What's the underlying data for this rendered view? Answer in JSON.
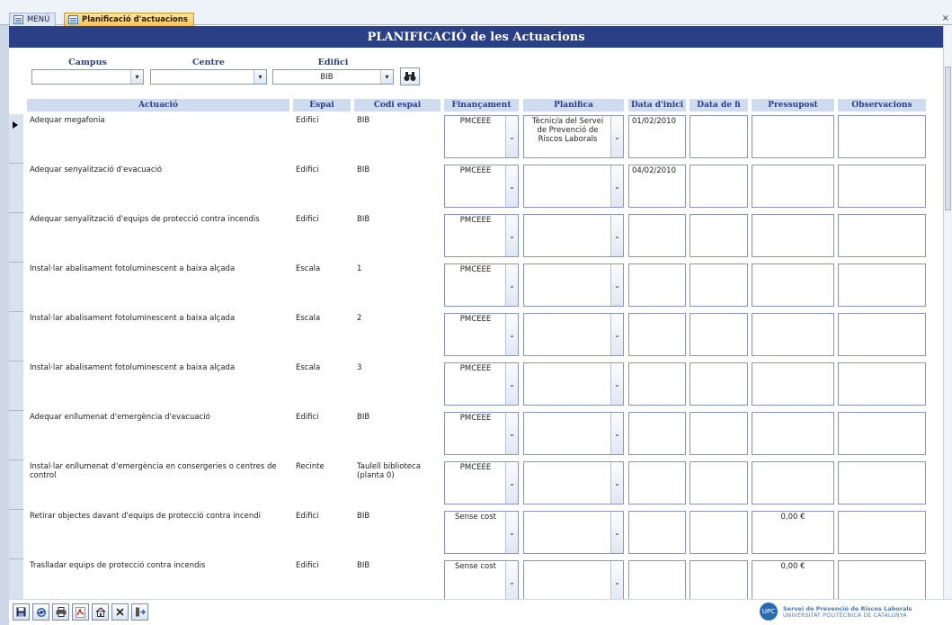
{
  "tabs": {
    "menu_label": "MENÚ",
    "active_label": "Planificació d'actuacions",
    "close_symbol": "×"
  },
  "title": "PLANIFICACIÓ de les Actuacions",
  "filters": {
    "campus_label": "Campus",
    "campus_value": "",
    "centre_label": "Centre",
    "centre_value": "",
    "edifici_label": "Edifici",
    "edifici_value": "BIB",
    "find_icon": "binoculars-icon"
  },
  "columns": [
    "Actuació",
    "Espai",
    "Codi espai",
    "Finançament",
    "Planifica",
    "Data d'inici",
    "Data de fi",
    "Pressupost",
    "Observacions"
  ],
  "rows": [
    {
      "actuacio": "Adequar megafonia",
      "espai": "Edifici",
      "codi": "BIB",
      "financament": "PMCEEE",
      "planifica": "Tècnic/a del Servei de Prevenció de Riscos Laborals",
      "inici": "01/02/2010",
      "fi": "",
      "pressupost": "",
      "observacions": ""
    },
    {
      "actuacio": "Adequar senyalització d'evacuació",
      "espai": "Edifici",
      "codi": "BIB",
      "financament": "PMCEEE",
      "planifica": "",
      "inici": "04/02/2010",
      "fi": "",
      "pressupost": "",
      "observacions": ""
    },
    {
      "actuacio": "Adequar senyalització d'equips de protecció contra incendis",
      "espai": "Edifici",
      "codi": "BIB",
      "financament": "PMCEEE",
      "planifica": "",
      "inici": "",
      "fi": "",
      "pressupost": "",
      "observacions": ""
    },
    {
      "actuacio": "Instal·lar abalisament fotoluminescent a baixa alçada",
      "espai": "Escala",
      "codi": "1",
      "financament": "PMCEEE",
      "planifica": "",
      "inici": "",
      "fi": "",
      "pressupost": "",
      "observacions": ""
    },
    {
      "actuacio": "Instal·lar abalisament fotoluminescent a baixa alçada",
      "espai": "Escala",
      "codi": "2",
      "financament": "PMCEEE",
      "planifica": "",
      "inici": "",
      "fi": "",
      "pressupost": "",
      "observacions": ""
    },
    {
      "actuacio": "Instal·lar abalisament fotoluminescent a baixa alçada",
      "espai": "Escala",
      "codi": "3",
      "financament": "PMCEEE",
      "planifica": "",
      "inici": "",
      "fi": "",
      "pressupost": "",
      "observacions": ""
    },
    {
      "actuacio": "Adequar enllumenat d'emergència d'evacuació",
      "espai": "Edifici",
      "codi": "BIB",
      "financament": "PMCEEE",
      "planifica": "",
      "inici": "",
      "fi": "",
      "pressupost": "",
      "observacions": ""
    },
    {
      "actuacio": "Instal·lar enllumenat d'emergència en consergeries o centres de control",
      "espai": "Recinte",
      "codi": "Taulell biblioteca (planta 0)",
      "financament": "PMCEEE",
      "planifica": "",
      "inici": "",
      "fi": "",
      "pressupost": "",
      "observacions": ""
    },
    {
      "actuacio": "Retirar objectes davant d'equips de protecció contra incendi",
      "espai": "Edifici",
      "codi": "BIB",
      "financament": "Sense cost",
      "planifica": "",
      "inici": "",
      "fi": "",
      "pressupost": "0,00 €",
      "observacions": ""
    },
    {
      "actuacio": "Traslladar equips de protecció contra incendis",
      "espai": "Edifici",
      "codi": "BIB",
      "financament": "Sense cost",
      "planifica": "",
      "inici": "",
      "fi": "",
      "pressupost": "0,00 €",
      "observacions": ""
    }
  ],
  "toolbar": [
    "save-icon",
    "refresh-icon",
    "print-icon",
    "pdf-icon",
    "home-icon",
    "close-icon",
    "exit-icon"
  ],
  "logo": {
    "line1": "Servei de Prevenció de Riscos Laborals",
    "line2": "UNIVERSITAT POLITÈCNICA DE CATALUNYA",
    "mark": "UPC"
  },
  "colors": {
    "title_bg": "#2b3f86",
    "header_bg": "#cfdcef",
    "cell_border": "#8a94c6",
    "active_tab": "#f6c45a"
  }
}
